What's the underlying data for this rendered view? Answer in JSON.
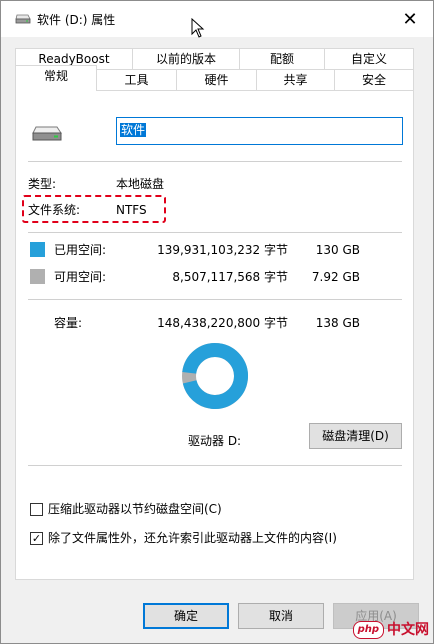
{
  "window": {
    "title": "软件 (D:) 属性",
    "close_glyph": "✕"
  },
  "tabs_row1": [
    {
      "label": "ReadyBoost"
    },
    {
      "label": "以前的版本"
    },
    {
      "label": "配额"
    },
    {
      "label": "自定义"
    }
  ],
  "tabs_row2": [
    {
      "label": "常规",
      "active": true
    },
    {
      "label": "工具"
    },
    {
      "label": "硬件"
    },
    {
      "label": "共享"
    },
    {
      "label": "安全"
    }
  ],
  "general": {
    "volume_name": "软件",
    "type_label": "类型:",
    "type_value": "本地磁盘",
    "fs_label": "文件系统:",
    "fs_value": "NTFS",
    "used_label": "已用空间:",
    "used_bytes": "139,931,103,232 字节",
    "used_gb": "130 GB",
    "free_label": "可用空间:",
    "free_bytes": "8,507,117,568 字节",
    "free_gb": "7.92 GB",
    "capacity_label": "容量:",
    "capacity_bytes": "148,438,220,800 字节",
    "capacity_gb": "138 GB",
    "drive_label": "驱动器 D:",
    "cleanup_button": "磁盘清理(D)",
    "compress_label": "压缩此驱动器以节约磁盘空间(C)",
    "compress_checked": false,
    "index_label": "除了文件属性外，还允许索引此驱动器上文件的内容(I)",
    "index_checked": true,
    "used_fraction": 0.9427,
    "colors": {
      "used": "#26a0da",
      "free": "#b0b0b0"
    }
  },
  "footer": {
    "ok": "确定",
    "cancel": "取消",
    "apply": "应用(A)"
  },
  "watermark": {
    "php": "php",
    "cn": "中文网"
  }
}
